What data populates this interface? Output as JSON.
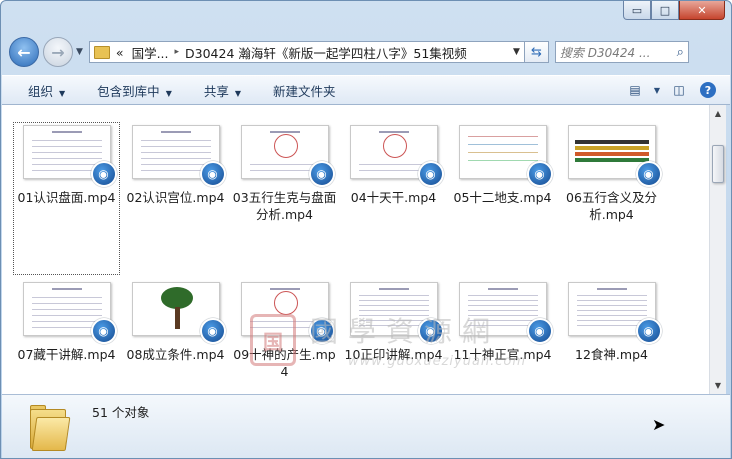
{
  "window": {
    "caption_buttons": {
      "minimize": "▭",
      "maximize": "□",
      "close": "✕"
    }
  },
  "nav": {
    "back_icon": "arrow-left",
    "forward_icon": "arrow-right",
    "address": {
      "prefix": "«",
      "parent": "国学...",
      "separator": "▸",
      "current": "D30424 瀚海轩《新版一起学四柱八字》51集视频"
    },
    "search": {
      "placeholder": "搜索 D30424 ..."
    }
  },
  "toolbar": {
    "organize": "组织",
    "include_in_library": "包含到库中",
    "share": "共享",
    "new_folder": "新建文件夹"
  },
  "files": [
    {
      "name": "01认识盘面.mp4",
      "thumb": "table"
    },
    {
      "name": "02认识宫位.mp4",
      "thumb": "table"
    },
    {
      "name": "03五行生克与盘面分析.mp4",
      "thumb": "diagram"
    },
    {
      "name": "04十天干.mp4",
      "thumb": "diagram"
    },
    {
      "name": "05十二地支.mp4",
      "thumb": "grid"
    },
    {
      "name": "06五行含义及分析.mp4",
      "thumb": "bars"
    },
    {
      "name": "07藏干讲解.mp4",
      "thumb": "table"
    },
    {
      "name": "08成立条件.mp4",
      "thumb": "tree"
    },
    {
      "name": "09十神的产生.mp4",
      "thumb": "diagram"
    },
    {
      "name": "10正印讲解.mp4",
      "thumb": "text"
    },
    {
      "name": "11十神正官.mp4",
      "thumb": "text"
    },
    {
      "name": "12食神.mp4",
      "thumb": "text"
    }
  ],
  "watermark": {
    "seal": "国",
    "title": "國學資源網",
    "url": "www.guoxueziyuan.com"
  },
  "status": {
    "count": "51 个对象"
  },
  "colors": {
    "accent": "#2d6fc2",
    "badge": "#14498f",
    "toolbar_text": "#1e395b"
  }
}
